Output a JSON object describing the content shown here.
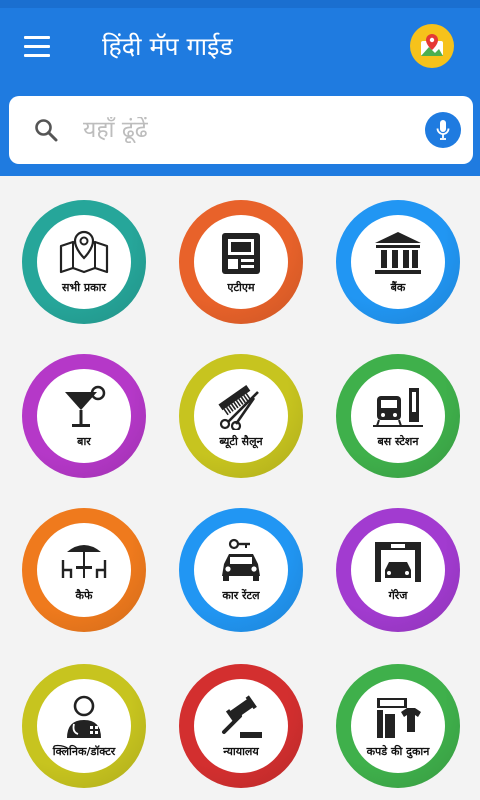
{
  "app": {
    "title": "हिंदी मॅप गाईड"
  },
  "search": {
    "placeholder": "यहाँ ढूंढें"
  },
  "categories": [
    {
      "label": "सभी प्रकार",
      "icon": "map-location-icon",
      "color": "#26a69a"
    },
    {
      "label": "एटीएम",
      "icon": "atm-icon",
      "color": "#e8622a"
    },
    {
      "label": "बैंक",
      "icon": "bank-icon",
      "color": "#2196f3"
    },
    {
      "label": "बार",
      "icon": "cocktail-icon",
      "color": "#b538c8"
    },
    {
      "label": "ब्यूटी सैलून",
      "icon": "comb-scissors-icon",
      "color": "#c7c41f"
    },
    {
      "label": "बस स्टेशन",
      "icon": "bus-station-icon",
      "color": "#3fb04b"
    },
    {
      "label": "कैफे",
      "icon": "cafe-table-icon",
      "color": "#ef7a1d"
    },
    {
      "label": "कार रेंटल",
      "icon": "car-rental-icon",
      "color": "#2196f3"
    },
    {
      "label": "गॅरेज",
      "icon": "garage-icon",
      "color": "#a23bd0"
    },
    {
      "label": "क्लिनिक/डॉक्टर",
      "icon": "doctor-icon",
      "color": "#c7c41f"
    },
    {
      "label": "न्यायालय",
      "icon": "gavel-icon",
      "color": "#d32f2f"
    },
    {
      "label": "कपडे की दुकान",
      "icon": "clothes-shop-icon",
      "color": "#3fb04b"
    }
  ]
}
